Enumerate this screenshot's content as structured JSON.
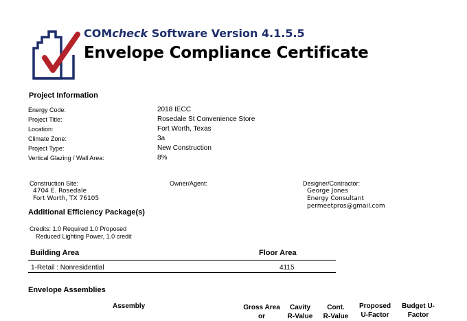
{
  "header": {
    "product_prefix": "COM",
    "product_check": "check",
    "product_suffix": " Software Version 4.1.5.5",
    "title": "Envelope Compliance Certificate"
  },
  "project_info": {
    "heading": "Project Information",
    "rows": [
      {
        "label": "Energy Code:",
        "value": "2018 IECC"
      },
      {
        "label": "Project Title:",
        "value": "Rosedale St Convenience Store"
      },
      {
        "label": "Location:",
        "value": "Fort Worth, Texas"
      },
      {
        "label": "Climate Zone:",
        "value": "3a"
      },
      {
        "label": "Project Type:",
        "value": "New Construction"
      },
      {
        "label": "Vertical Glazing / Wall Area:",
        "value": "8%"
      }
    ]
  },
  "parties": {
    "construction_site": {
      "label": "Construction Site:",
      "line1": "4704 E. Rosedale",
      "line2": "Fort Worth, TX 76105"
    },
    "owner": {
      "label": "Owner/Agent:"
    },
    "designer": {
      "label": "Designer/Contractor:",
      "line1": "George Jones",
      "line2": "Energy Consultant",
      "line3": "permeetpros@gmail.com"
    }
  },
  "efficiency": {
    "heading": "Additional Efficiency Package(s)",
    "credits": "Credits:  1.0 Required   1.0 Proposed",
    "detail": "Reduced Lighting Power, 1.0 credit"
  },
  "building_area": {
    "col1": "Building Area",
    "col2": "Floor Area",
    "rows": [
      {
        "name": "1-Retail : Nonresidential",
        "area": "4115"
      }
    ]
  },
  "envelope": {
    "heading": "Envelope Assemblies",
    "columns": {
      "assembly": "Assembly",
      "gross_area_1": "Gross Area",
      "gross_area_2": "or",
      "cavity_1": "Cavity",
      "cavity_2": "R-Value",
      "cont_1": "Cont.",
      "cont_2": "R-Value",
      "proposed_1": "Proposed",
      "proposed_2": "U-Factor",
      "budget_1": "Budget U-",
      "budget_2": "Factor"
    }
  }
}
